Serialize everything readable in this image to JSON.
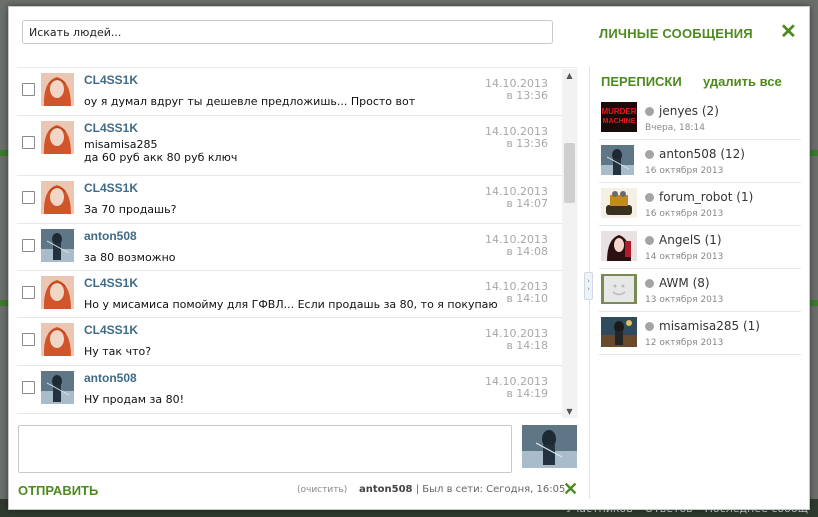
{
  "search": {
    "placeholder": "Искать людей..."
  },
  "header": {
    "title": "ЛИЧНЫЕ СООБЩЕНИЯ"
  },
  "messages": [
    {
      "author": "CL4SS1K",
      "text": "оу я думал вдруг ты дешевле предложишь... Просто вот",
      "date": "14.10.2013",
      "time": "в 13:36",
      "avatar": "red-hair"
    },
    {
      "author": "CL4SS1K",
      "text": "misamisa285\nда 60 руб акк 80 руб ключ",
      "date": "14.10.2013",
      "time": "в 13:36",
      "avatar": "red-hair"
    },
    {
      "author": "CL4SS1K",
      "text": "За 70 продашь?",
      "date": "14.10.2013",
      "time": "в 14:07",
      "avatar": "red-hair"
    },
    {
      "author": "anton508",
      "text": "за 80 возможно",
      "date": "14.10.2013",
      "time": "в 14:08",
      "avatar": "dark-figure"
    },
    {
      "author": "CL4SS1K",
      "text": "Но у мисамиса помойму для ГФВЛ... Если продашь за 80, то я покупаю",
      "date": "14.10.2013",
      "time": "в 14:10",
      "avatar": "red-hair"
    },
    {
      "author": "CL4SS1K",
      "text": "Ну так что?",
      "date": "14.10.2013",
      "time": "в 14:18",
      "avatar": "red-hair"
    },
    {
      "author": "anton508",
      "text": "НУ продам за 80!",
      "date": "14.10.2013",
      "time": "в 14:19",
      "avatar": "dark-figure"
    }
  ],
  "composer": {
    "send_label": "ОТПРАВИТЬ",
    "clear_label": "(очистить)",
    "user": "anton508",
    "status": "| Был в сети: Сегодня, 16:05"
  },
  "conversations": {
    "title": "ПЕРЕПИСКИ",
    "delete_all": "удалить все",
    "items": [
      {
        "name": "jenyes (2)",
        "date": "Вчера, 18:14",
        "avatar": "murder-machine"
      },
      {
        "name": "anton508 (12)",
        "date": "16 октября 2013",
        "avatar": "dark-figure"
      },
      {
        "name": "forum_robot (1)",
        "date": "16 октября 2013",
        "avatar": "robot"
      },
      {
        "name": "AngelS (1)",
        "date": "14 октября 2013",
        "avatar": "angel"
      },
      {
        "name": "AWM (8)",
        "date": "13 октября 2013",
        "avatar": "smiley"
      },
      {
        "name": "misamisa285 (1)",
        "date": "12 октября 2013",
        "avatar": "soldier"
      }
    ]
  },
  "background": {
    "bottom_links": [
      "Участников",
      "Ответов",
      "Последнее сообщ"
    ]
  },
  "colors": {
    "accent": "#4e8a1f",
    "author": "#3f6b87",
    "date": "#a8a8a8"
  }
}
